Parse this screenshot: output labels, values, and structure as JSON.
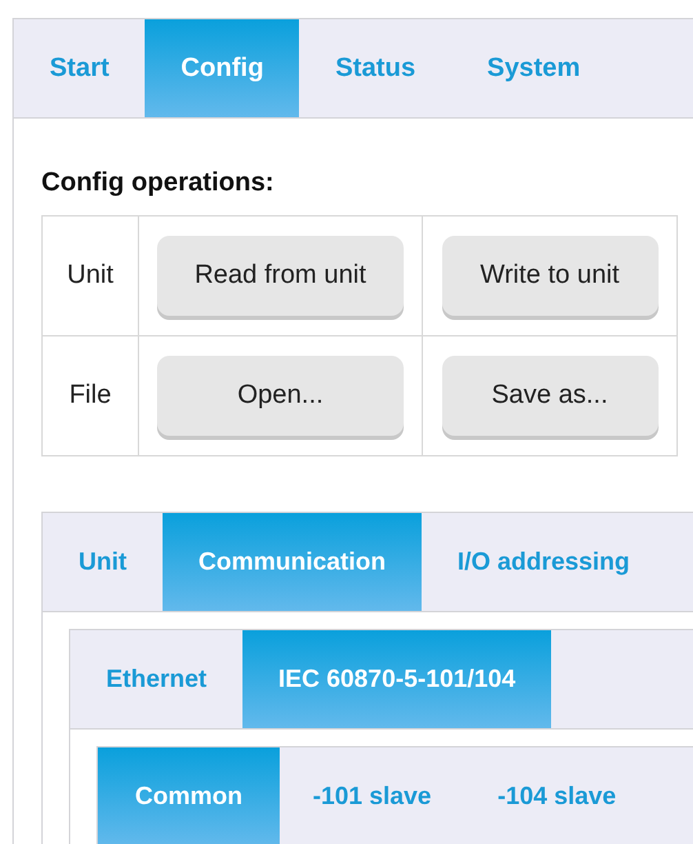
{
  "tabs": [
    {
      "label": "Start",
      "selected": false
    },
    {
      "label": "Config",
      "selected": true
    },
    {
      "label": "Status",
      "selected": false
    },
    {
      "label": "System",
      "selected": false
    }
  ],
  "config_operations": {
    "heading": "Config operations:",
    "rows": [
      {
        "label": "Unit",
        "buttons": [
          "Read from unit",
          "Write to unit"
        ]
      },
      {
        "label": "File",
        "buttons": [
          "Open...",
          "Save as..."
        ]
      }
    ]
  },
  "config_tabs": [
    {
      "label": "Unit",
      "selected": false
    },
    {
      "label": "Communication",
      "selected": true
    },
    {
      "label": "I/O addressing",
      "selected": false
    }
  ],
  "communication_tabs": [
    {
      "label": "Ethernet",
      "selected": false
    },
    {
      "label": "IEC 60870-5-101/104",
      "selected": true
    }
  ],
  "protocol_tabs": [
    {
      "label": "Common",
      "selected": true
    },
    {
      "label": "-101 slave",
      "selected": false
    },
    {
      "label": "-104 slave",
      "selected": false
    }
  ]
}
